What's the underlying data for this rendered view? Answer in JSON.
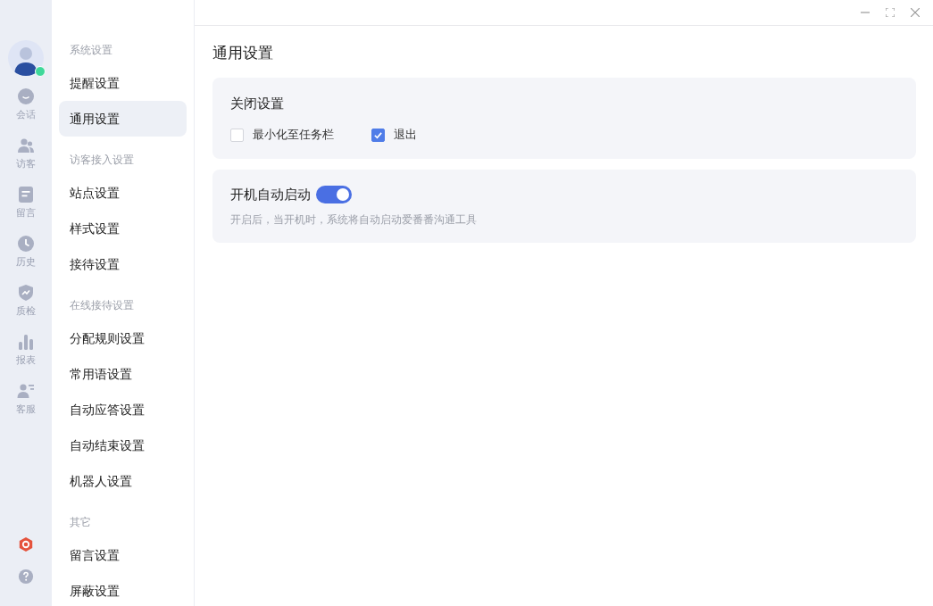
{
  "rail": {
    "avatar": {
      "online": true
    },
    "items": [
      {
        "label": "会话"
      },
      {
        "label": "访客"
      },
      {
        "label": "留言"
      },
      {
        "label": "历史"
      },
      {
        "label": "质检"
      },
      {
        "label": "报表"
      },
      {
        "label": "客服"
      }
    ]
  },
  "sidebar": {
    "groups": [
      {
        "title": "系统设置",
        "items": [
          {
            "label": "提醒设置",
            "selected": false
          },
          {
            "label": "通用设置",
            "selected": true
          }
        ]
      },
      {
        "title": "访客接入设置",
        "items": [
          {
            "label": "站点设置",
            "selected": false
          },
          {
            "label": "样式设置",
            "selected": false
          },
          {
            "label": "接待设置",
            "selected": false
          }
        ]
      },
      {
        "title": "在线接待设置",
        "items": [
          {
            "label": "分配规则设置",
            "selected": false
          },
          {
            "label": "常用语设置",
            "selected": false
          },
          {
            "label": "自动应答设置",
            "selected": false
          },
          {
            "label": "自动结束设置",
            "selected": false
          },
          {
            "label": "机器人设置",
            "selected": false
          }
        ]
      },
      {
        "title": "其它",
        "items": [
          {
            "label": "留言设置",
            "selected": false
          },
          {
            "label": "屏蔽设置",
            "selected": false
          }
        ]
      }
    ]
  },
  "page": {
    "title": "通用设置",
    "close_settings": {
      "title": "关闭设置",
      "options": [
        {
          "label": "最小化至任务栏",
          "checked": false
        },
        {
          "label": "退出",
          "checked": true
        }
      ]
    },
    "autostart": {
      "title": "开机自动启动",
      "on": true,
      "description": "开启后，当开机时，系统将自动启动爱番番沟通工具"
    }
  }
}
